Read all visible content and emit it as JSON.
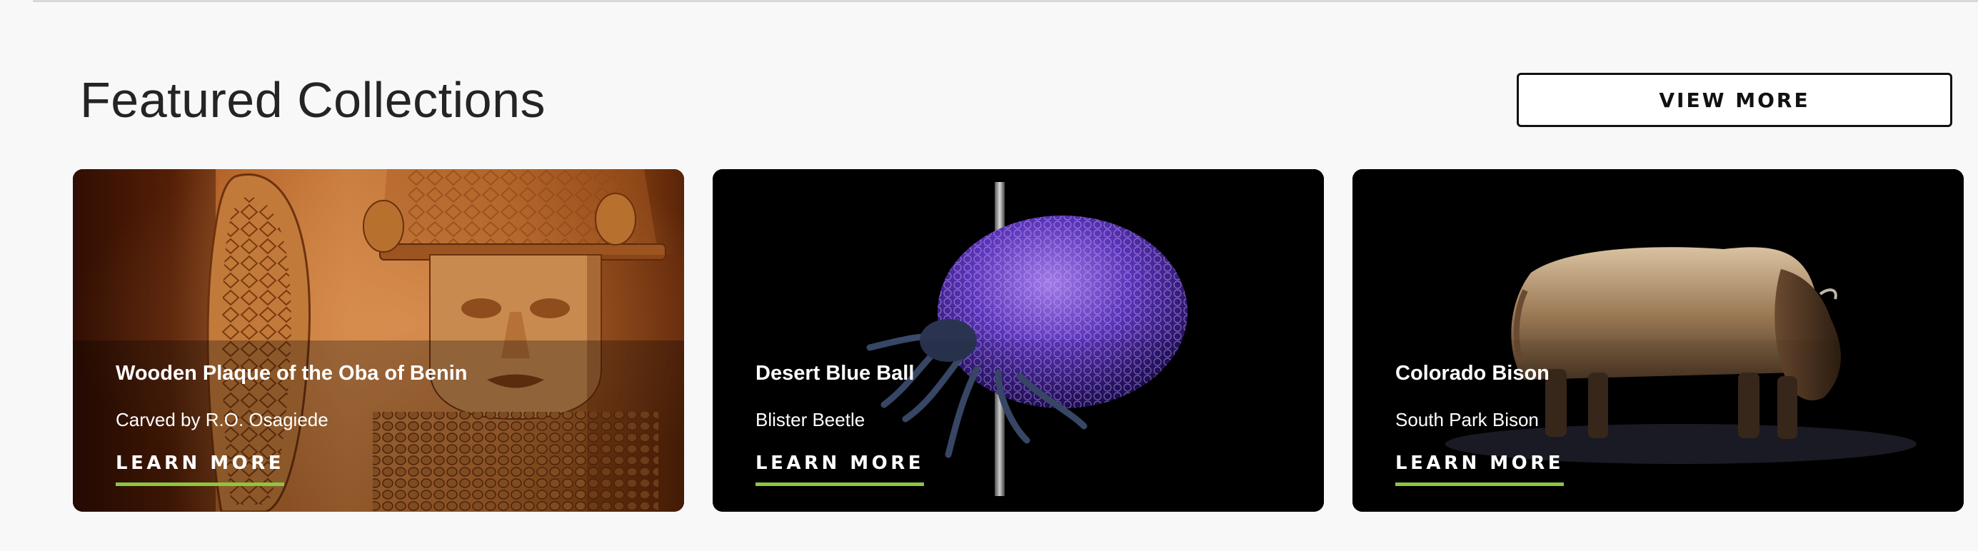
{
  "section": {
    "title": "Featured Collections",
    "view_more_label": "VIEW MORE"
  },
  "cards": [
    {
      "title": "Wooden Plaque of the Oba of Benin",
      "subtitle": "Carved by R.O. Osagiede",
      "link_label": "LEARN MORE",
      "image": "carved-wooden-plaque"
    },
    {
      "title": "Desert Blue Ball",
      "subtitle": "Blister Beetle",
      "link_label": "LEARN MORE",
      "image": "purple-beetle-on-pin"
    },
    {
      "title": "Colorado Bison",
      "subtitle": "South Park Bison",
      "link_label": "LEARN MORE",
      "image": "bison-specimen"
    }
  ],
  "colors": {
    "background": "#f8f8f8",
    "link_underline": "#8cc63f",
    "card_background": "#000000"
  }
}
